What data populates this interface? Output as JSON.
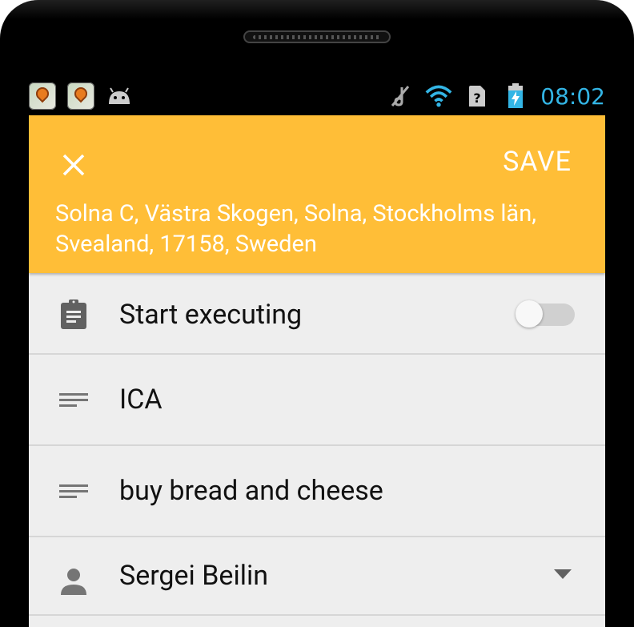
{
  "status_bar": {
    "time": "08:02",
    "icons": [
      "location-notification-icon",
      "location-notification-icon",
      "android-icon",
      "mute-icon",
      "wifi-icon",
      "no-sim-icon",
      "battery-charging-icon"
    ]
  },
  "toolbar": {
    "save_label": "SAVE",
    "location_text": "Solna C, Västra Skogen, Solna, Stockholms län, Svealand, 17158, Sweden",
    "background_color": "#ffbe37"
  },
  "rows": {
    "start_executing": {
      "label": "Start executing",
      "enabled": false
    },
    "title": "ICA",
    "description": "buy bread and cheese",
    "assignee": "Sergei Beilin"
  },
  "colors": {
    "accent": "#ffbe37",
    "clock": "#33b5e5",
    "content_bg": "#eeeeee"
  }
}
